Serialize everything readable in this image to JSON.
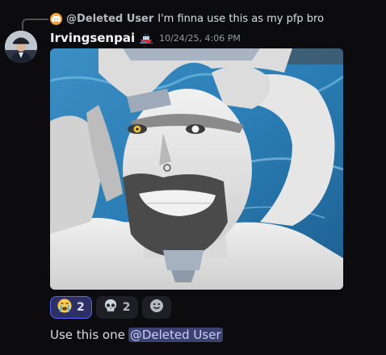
{
  "reply": {
    "author": "@Deleted User",
    "text": "I'm finna use this as my pfp bro",
    "avatar_icon": "discord-logo-icon",
    "avatar_color": "#f0a232"
  },
  "message": {
    "author": "Irvingsenpai",
    "badge_icon": "ship-emoji-icon",
    "timestamp": "10/24/25, 4:06 PM",
    "text": "Use this one",
    "mention": "@Deleted User"
  },
  "reactions": [
    {
      "emoji": "😭",
      "icon": "loudly-crying-face-icon",
      "count": "2",
      "active": true
    },
    {
      "emoji": "💀",
      "icon": "skull-icon",
      "count": "2",
      "active": false
    }
  ],
  "add_reaction_icon": "add-reaction-smiley-icon",
  "colors": {
    "background": "#0c0c0f",
    "mention_bg": "#3c4270",
    "reaction_active_border": "#5865f2"
  }
}
